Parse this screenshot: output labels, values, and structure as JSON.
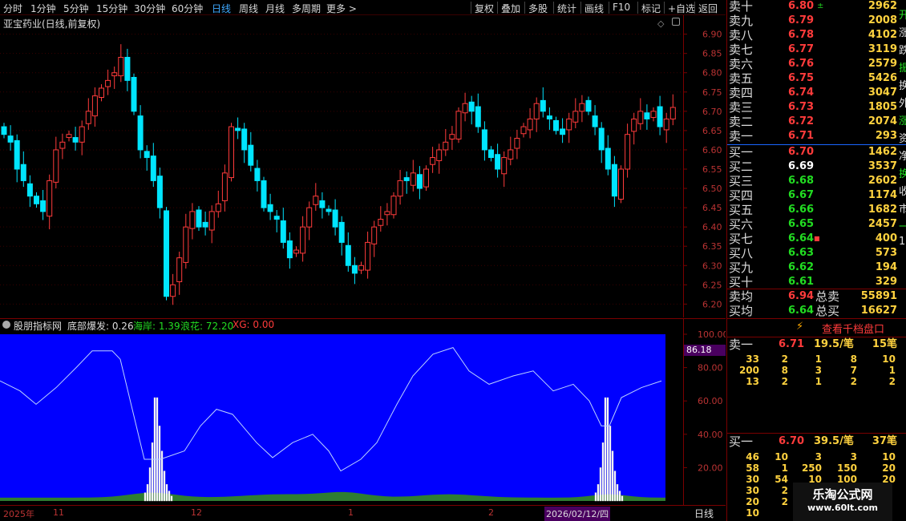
{
  "toolbar": {
    "periods": [
      "分时",
      "1分钟",
      "5分钟",
      "15分钟",
      "30分钟",
      "60分钟",
      "日线",
      "周线",
      "月线",
      "多周期",
      "更多 >"
    ],
    "active_period": "日线",
    "actions": [
      "复权",
      "叠加",
      "多股",
      "统计",
      "画线",
      "F10",
      "标记",
      "+自选",
      "返回"
    ]
  },
  "main_chart": {
    "title": "亚宝药业(日线,前复权)",
    "price_ticks": [
      "6.90",
      "6.85",
      "6.80",
      "6.75",
      "6.70",
      "6.65",
      "6.60",
      "6.55",
      "6.50",
      "6.45",
      "6.40",
      "6.35",
      "6.30",
      "6.25",
      "6.20"
    ],
    "up_color": "#ff3b3b",
    "down_color": "#00e5ff"
  },
  "indicator": {
    "name": "股朋指标网",
    "label1": "底部爆发: 0.26",
    "label2": "海岸: 1.39",
    "label3": "浪花: 72.20",
    "label4": "XG: 0.00",
    "ticks": [
      "100.00",
      "80.00",
      "60.00",
      "40.00",
      "20.00"
    ],
    "current_value": "86.18",
    "background_color": "#0000ff"
  },
  "date_bar": {
    "labels": [
      "2025年",
      "11",
      "12",
      "1",
      "2"
    ],
    "cursor_date": "2026/02/12/四",
    "period": "日线"
  },
  "orderbook": {
    "asks": [
      {
        "label": "卖十",
        "price": "6.80",
        "vol": "2962",
        "mark": "±"
      },
      {
        "label": "卖九",
        "price": "6.79",
        "vol": "2008"
      },
      {
        "label": "卖八",
        "price": "6.78",
        "vol": "4102"
      },
      {
        "label": "卖七",
        "price": "6.77",
        "vol": "3119"
      },
      {
        "label": "卖六",
        "price": "6.76",
        "vol": "2579"
      },
      {
        "label": "卖五",
        "price": "6.75",
        "vol": "5426"
      },
      {
        "label": "卖四",
        "price": "6.74",
        "vol": "3047"
      },
      {
        "label": "卖三",
        "price": "6.73",
        "vol": "1805"
      },
      {
        "label": "卖二",
        "price": "6.72",
        "vol": "2074"
      },
      {
        "label": "卖一",
        "price": "6.71",
        "vol": "293"
      }
    ],
    "bids": [
      {
        "label": "买一",
        "price": "6.70",
        "vol": "1462",
        "color": "#ff3b3b"
      },
      {
        "label": "买二",
        "price": "6.69",
        "vol": "3537",
        "color": "#ffffff"
      },
      {
        "label": "买三",
        "price": "6.68",
        "vol": "2602",
        "color": "#22dd22"
      },
      {
        "label": "买四",
        "price": "6.67",
        "vol": "1174",
        "color": "#22dd22"
      },
      {
        "label": "买五",
        "price": "6.66",
        "vol": "1682",
        "color": "#22dd22"
      },
      {
        "label": "买六",
        "price": "6.65",
        "vol": "2457",
        "color": "#22dd22"
      },
      {
        "label": "买七",
        "price": "6.64",
        "vol": "400",
        "color": "#22dd22",
        "mark": "■"
      },
      {
        "label": "买八",
        "price": "6.63",
        "vol": "573",
        "color": "#22dd22"
      },
      {
        "label": "买九",
        "price": "6.62",
        "vol": "194",
        "color": "#22dd22"
      },
      {
        "label": "买十",
        "price": "6.61",
        "vol": "329",
        "color": "#22dd22"
      }
    ],
    "avg_ask_label": "卖均",
    "avg_ask_price": "6.94",
    "total_ask_label": "总卖",
    "total_ask": "55891",
    "avg_bid_label": "买均",
    "avg_bid_price": "6.64",
    "total_bid_label": "总买",
    "total_bid": "16627",
    "depth_button": "查看千档盘口",
    "ask1_label": "卖一",
    "ask1_price": "6.71",
    "ask1_per": "19.5/笔",
    "ask1_count": "15笔",
    "ask_queue": [
      [
        "33",
        "2",
        "1",
        "8",
        "10"
      ],
      [
        "200",
        "8",
        "3",
        "7",
        "1"
      ],
      [
        "13",
        "2",
        "1",
        "2",
        "2"
      ]
    ],
    "bid1_label": "买一",
    "bid1_price": "6.70",
    "bid1_per": "39.5/笔",
    "bid1_count": "37笔",
    "bid_queue": [
      [
        "46",
        "10",
        "3",
        "3",
        "10"
      ],
      [
        "58",
        "1",
        "250",
        "150",
        "20"
      ],
      [
        "30",
        "54",
        "10",
        "100",
        "20"
      ],
      [
        "30",
        "2",
        "",
        "",
        ""
      ],
      [
        "20",
        "2",
        "",
        "",
        ""
      ],
      [
        "10",
        "",
        "",
        "",
        ""
      ]
    ],
    "side_fragments": [
      "开",
      "涨",
      "跌",
      "振",
      "换",
      "外",
      "涨",
      "资",
      "净",
      "换",
      "收",
      "市",
      "一",
      "1"
    ]
  },
  "watermark": {
    "line1": "乐淘公式网",
    "line2": "www.60lt.com"
  }
}
